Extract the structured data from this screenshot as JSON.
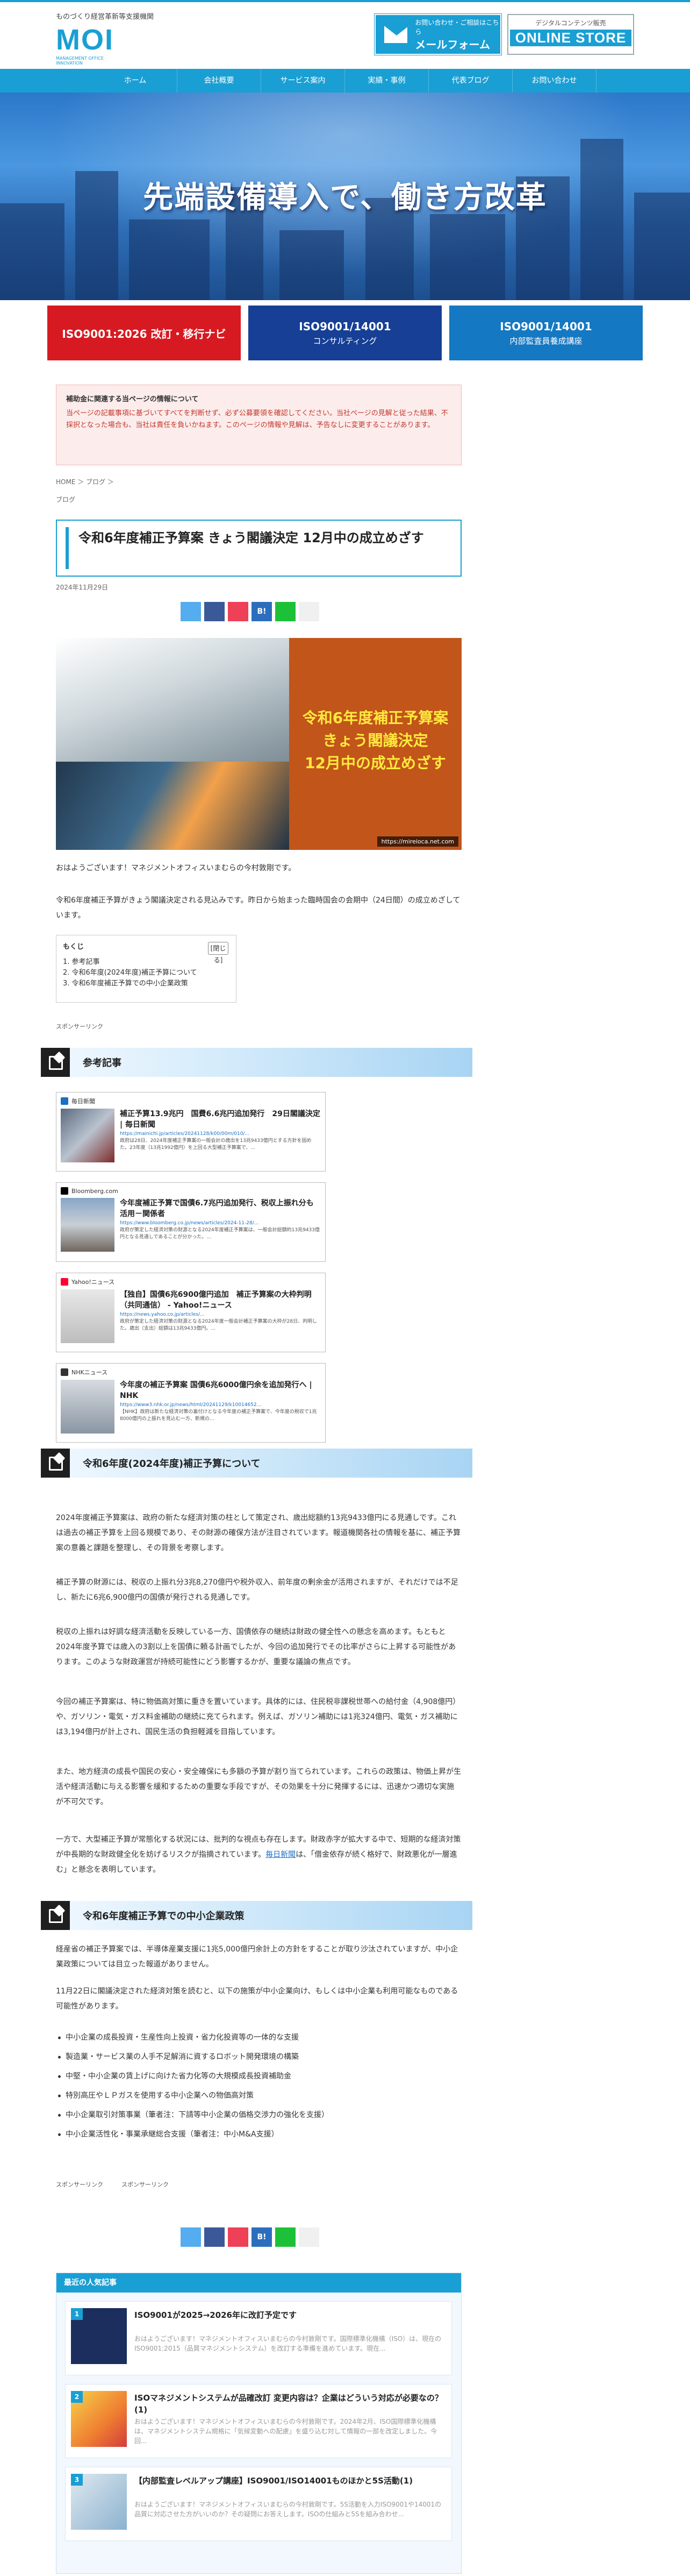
{
  "header": {
    "tagline": "ものづくり経営革新等支援機関",
    "logo_text": "MOI",
    "logo_sub": "MANAGEMENT OFFICE INNOVATION",
    "mail_line1": "お問い合わせ・ご相談はこちら",
    "mail_line2": "メールフォーム",
    "store_line1": "デジタルコンテンツ販売",
    "store_line2": "ONLINE STORE"
  },
  "nav": [
    "ホーム",
    "会社概要",
    "サービス案内",
    "実績・事例",
    "代表ブログ",
    "お問い合わせ"
  ],
  "hero": {
    "title": "先端設備導入で、働き方改革"
  },
  "cta": [
    {
      "line1": "ISO9001:2026 改訂・移行ナビ",
      "line2": "",
      "color": "#d71a21"
    },
    {
      "line1": "ISO9001/14001",
      "line2": "コンサルティング",
      "color": "#163f95"
    },
    {
      "line1": "ISO9001/14001",
      "line2": "内部監査員養成講座",
      "color": "#1578c2"
    }
  ],
  "notice": {
    "title": "補助金に関連する当ページの情報について",
    "body": "当ページの記載事項に基づいてすべてを判断せず、必ず公募要領を確認してください。当社ページの見解と従った結果、不採択となった場合も、当社は責任を負いかねます。このページの情報や見解は、予告なしに変更することがあります。"
  },
  "breadcrumb": "HOME ＞ ブログ ＞",
  "category": "ブログ",
  "article": {
    "title": "令和6年度補正予算案 きょう閣議決定 12月中の成立めざす",
    "date": "2024年11月29日",
    "eyecatch_lines": [
      "令和6年度補正予算案",
      "きょう閣議決定",
      "12月中の成立めざす"
    ],
    "eyecatch_url": "https://mireioca.net.com",
    "intro1": "おはようございます！マネジメントオフィスいまむらの今村敦剛です。",
    "intro2": "令和6年度補正予算がきょう閣議決定される見込みです。昨日から始まった臨時国会の会期中（24日間）の成立めざしています。"
  },
  "share_labels": [
    "",
    "",
    "",
    "B!",
    "",
    ""
  ],
  "share_colors": [
    "#55acee",
    "#3b5998",
    "#ee4056",
    "#2c6ebd",
    "#1dc137",
    "#f0f0f0"
  ],
  "toc": {
    "title": "もくじ",
    "toggle": "[閉じる]",
    "items": [
      "1. 参考記事",
      "2. 令和6年度(2024年度)補正予算について",
      "3. 令和6年度補正予算での中小企業政策"
    ]
  },
  "sponsor": "スポンサーリンク",
  "sections": {
    "s1": "参考記事",
    "s2": "令和6年度(2024年度)補正予算について",
    "s3": "令和6年度補正予算での中小企業政策"
  },
  "refs": [
    {
      "source": "毎日新聞",
      "title": "補正予算13.9兆円　国費6.6兆円追加発行　29日閣議決定 | 毎日新聞",
      "url": "https://mainichi.jp/articles/20241128/k00/00m/010/...",
      "desc": "政府は28日、2024年度補正予算案の一般会計の歳出を13兆9433億円とする方針を固めた。23年度（13兆1992億円）を上回る大型補正予算案で、..."
    },
    {
      "source": "Bloomberg.com",
      "title": "今年度補正予算で国債6.7兆円追加発行、税収上振れ分も活用－関係者",
      "url": "https://www.bloomberg.co.jp/news/articles/2024-11-28/...",
      "desc": "政府が策定した経済対策の財源となる2024年度補正予算案は、一般会計総額約13兆9433億円となる見通しであることが分かった。..."
    },
    {
      "source": "Yahoo!ニュース",
      "title": "【独自】国債6兆6900億円追加　補正予算案の大枠判明（共同通信） - Yahoo!ニュース",
      "url": "https://news.yahoo.co.jp/articles/...",
      "desc": "政府が策定した経済対策の財源となる2024年度一般会計補正予算案の大枠が28日、判明した。歳出（支出）総額は13兆9433億円。..."
    },
    {
      "source": "NHKニュース",
      "title": "今年度の補正予算案 国債6兆6000億円余を追加発行へ | NHK",
      "url": "https://www3.nhk.or.jp/news/html/20241129/k10014652...",
      "desc": "【NHK】政府は新たな経済対策の裏付けとなる今年度の補正予算案で、今年度の税収で1兆8000億円の上振れを見込む一方、新規の..."
    }
  ],
  "budget_paras": [
    "2024年度補正予算案は、政府の新たな経済対策の柱として策定され、歳出総額約13兆9433億円にる見通しです。これは過去の補正予算を上回る規模であり、その財源の確保方法が注目されています。報道機関各社の情報を基に、補正予算案の意義と課題を整理し、その背景を考察します。",
    "補正予算の財源には、税収の上振れ分3兆8,270億円や税外収入、前年度の剰余金が活用されますが、それだけでは不足し、新たに6兆6,900億円の国債が発行される見通しです。",
    "税収の上振れは好調な経済活動を反映している一方、国債依存の継続は財政の健全性への懸念を高めます。もともと2024年度予算では歳入の3割以上を国債に頼る計画でしたが、今回の追加発行でその比率がさらに上昇する可能性があります。このような財政運営が持続可能性にどう影響するかが、重要な議論の焦点です。",
    "今回の補正予算案は、特に物価高対策に重きを置いています。具体的には、住民税非課税世帯への給付金（4,908億円）や、ガソリン・電気・ガス料金補助の継続に充てられます。例えば、ガソリン補助には1兆324億円、電気・ガス補助には3,194億円が計上され、国民生活の負担軽減を目指しています。",
    "また、地方経済の成長や国民の安心・安全確保にも多額の予算が割り当てられています。これらの政策は、物価上昇が生活や経済活動に与える影響を緩和するための重要な手段ですが、その効果を十分に発揮するには、迅速かつ適切な実施が不可欠です。",
    "一方で、大型補正予算が常態化する状況には、批判的な視点も存在します。財政赤字が拡大する中で、短期的な経済対策が中長期的な財政健全化を妨げるリスクが指摘されています。"
  ],
  "budget_link": "毎日新聞",
  "budget_tail": "は、「借金依存が続く格好で、財政悪化が一層進む」と懸念を表明しています。",
  "sme_paras": [
    "経産省の補正予算案では、半導体産業支援に1兆5,000億円余計上の方針をすることが取り沙汰されていますが、中小企業政策については目立った報道がありません。",
    "11月22日に閣議決定された経済対策を読むと、以下の施策が中小企業向け、もしくは中小企業も利用可能なものである可能性があります。"
  ],
  "sme_list": [
    "中小企業の成長投資・生産性向上投資・省力化投資等の一体的な支援",
    "製造業・サービス業の人手不足解消に資するロボット開発環境の構築",
    "中堅・中小企業の賃上げに向けた省力化等の大規模成長投資補助金",
    "特別高圧やＬＰガスを使用する中小企業への物価高対策",
    "中小企業取引対策事業（筆者注：下請等中小企業の価格交渉力の強化を支援）",
    "中小企業活性化・事業承継総合支援（筆者注：中小M&A支援）"
  ],
  "sponsor_pair": [
    "スポンサーリンク",
    "スポンサーリンク"
  ],
  "popular": {
    "title": "最近の人気記事",
    "items": [
      {
        "rank": "1",
        "title": "ISO9001が2025→2026年に改訂予定です",
        "desc": "おはようございます！マネジメントオフィスいまむらの今村敦剛です。国際標準化機構（ISO）は、現在のISO9001:2015（品質マネジメントシステム）を改訂する準備を進めています。現在..."
      },
      {
        "rank": "2",
        "title": "ISOマネジメントシステムが品確改訂 変更内容は？企業はどういう対応が必要なの？(1)",
        "desc": "おはようございます！マネジメントオフィスいまむらの今村敦剛です。2024年2月、ISO国際標準化機構は、マネジメントシステム規格に「気候変動への配慮」を盛り込む対して情報の一部を改定しました。今回..."
      },
      {
        "rank": "3",
        "title": "【内部監査レベルアップ講座】ISO9001/ISO14001ものほかと5S活動(1)",
        "desc": "おはようございます！マネジメントオフィスいまむらの今村敦剛です。5S活動を入力ISO9001や14001の品質に対応させた方がいいのか？その疑問にお答えします。ISOの仕組みと5Sを組み合わせ..."
      }
    ]
  }
}
